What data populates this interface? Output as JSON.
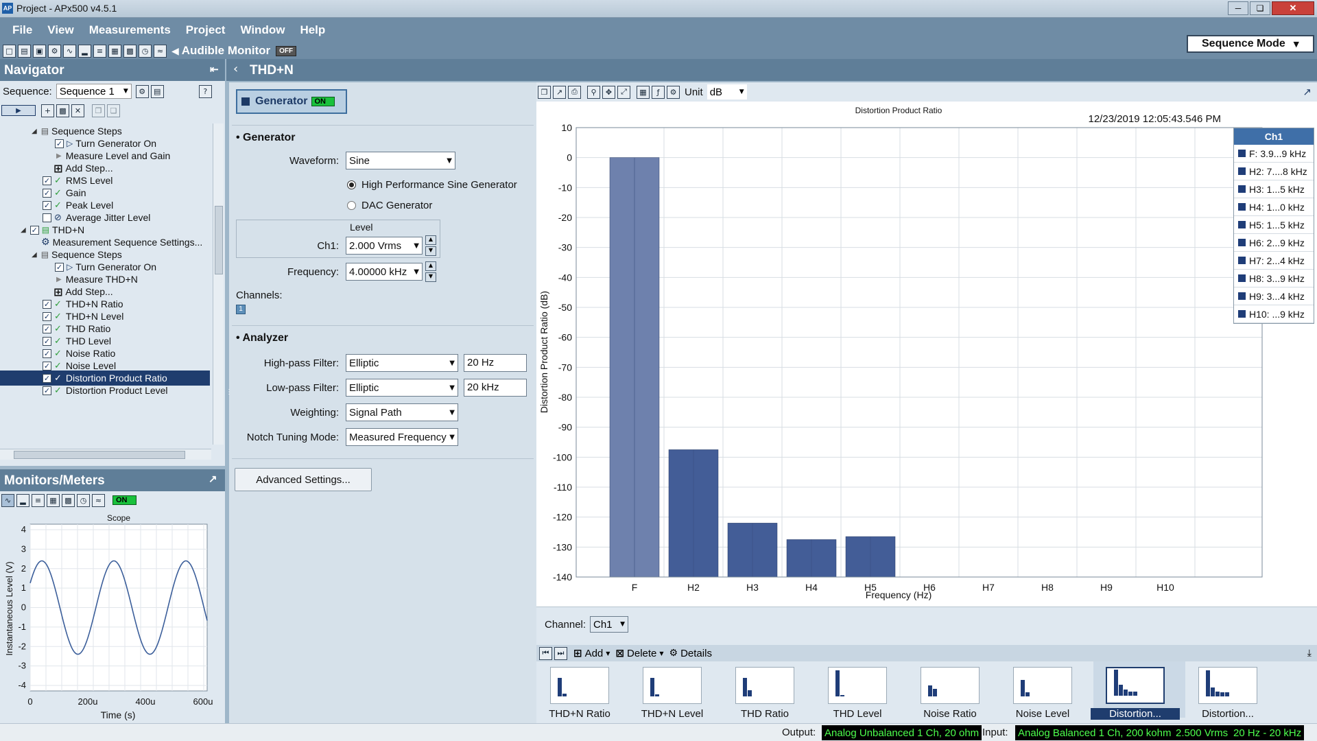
{
  "titlebar": {
    "title": "Project - APx500 v4.5.1"
  },
  "menu": {
    "items": [
      "File",
      "View",
      "Measurements",
      "Project",
      "Window",
      "Help"
    ],
    "audible_monitor": "Audible Monitor",
    "audible_state": "OFF",
    "mode": "Sequence Mode"
  },
  "navigator": {
    "title": "Navigator",
    "sequence_label": "Sequence:",
    "sequence_value": "Sequence 1",
    "items": [
      "Sequence Steps",
      "Turn Generator On",
      "Measure Level and Gain",
      "Add Step...",
      "RMS Level",
      "Gain",
      "Peak Level",
      "Average Jitter Level",
      "THD+N",
      "Measurement Sequence Settings...",
      "Sequence Steps",
      "Turn Generator On",
      "Measure THD+N",
      "Add Step...",
      "THD+N Ratio",
      "THD+N Level",
      "THD Ratio",
      "THD Level",
      "Noise Ratio",
      "Noise Level",
      "Distortion Product Ratio",
      "Distortion Product Level"
    ]
  },
  "monitors": {
    "title": "Monitors/Meters",
    "state": "ON",
    "scope": {
      "title": "Scope",
      "ylabel": "Instantaneous Level (V)",
      "xlabel": "Time (s)",
      "yticks": [
        "4",
        "3",
        "2",
        "1",
        "0",
        "-1",
        "-2",
        "-3",
        "-4"
      ],
      "xticks": [
        "0",
        "200u",
        "400u",
        "600u"
      ]
    }
  },
  "measurement": {
    "title": "THD+N"
  },
  "generator": {
    "button": "Generator",
    "state": "ON",
    "section": "Generator",
    "waveform_label": "Waveform:",
    "waveform": "Sine",
    "radio1": "High Performance Sine Generator",
    "radio2": "DAC Generator",
    "level_label": "Level",
    "ch1_label": "Ch1:",
    "ch1_value": "2.000 Vrms",
    "freq_label": "Frequency:",
    "freq_value": "4.00000 kHz",
    "channels_label": "Channels:",
    "channel_badge": "1"
  },
  "analyzer": {
    "section": "Analyzer",
    "hp_label": "High-pass Filter:",
    "hp_value": "Elliptic",
    "hp_freq": "20 Hz",
    "lp_label": "Low-pass Filter:",
    "lp_value": "Elliptic",
    "lp_freq": "20 kHz",
    "weight_label": "Weighting:",
    "weight_value": "Signal Path",
    "notch_label": "Notch Tuning Mode:",
    "notch_value": "Measured Frequency",
    "advanced": "Advanced Settings..."
  },
  "graph_toolbar": {
    "unit_label": "Unit",
    "unit_value": "dB"
  },
  "chart_data": {
    "type": "bar",
    "title": "Distortion Product Ratio",
    "timestamp": "12/23/2019 12:05:43.546 PM",
    "xlabel": "Frequency (Hz)",
    "ylabel": "Distortion Product Ratio (dB)",
    "categories": [
      "F",
      "H2",
      "H3",
      "H4",
      "H5",
      "H6",
      "H7",
      "H8",
      "H9",
      "H10"
    ],
    "values": [
      0,
      -97.5,
      -122,
      -127.5,
      -126.5,
      null,
      null,
      null,
      null,
      null
    ],
    "ylim": [
      -140,
      10
    ],
    "yticks": [
      10,
      0,
      -10,
      -20,
      -30,
      -40,
      -50,
      -60,
      -70,
      -80,
      -90,
      -100,
      -110,
      -120,
      -130,
      -140
    ],
    "colors": [
      "#6e81ad",
      "#435d97",
      "#435d97",
      "#435d97",
      "#435d97"
    ],
    "legend": {
      "header": "Ch1",
      "entries": [
        "F: 3.9...9 kHz",
        "H2: 7....8 kHz",
        "H3: 1...5 kHz",
        "H4: 1...0 kHz",
        "H5: 1...5 kHz",
        "H6: 2...9 kHz",
        "H7: 2...4 kHz",
        "H8: 3...9 kHz",
        "H9: 3...4 kHz",
        "H10: ...9 kHz"
      ]
    }
  },
  "channel_select": {
    "label": "Channel:",
    "value": "Ch1"
  },
  "results_bar": {
    "add": "Add",
    "delete": "Delete",
    "details": "Details"
  },
  "results": [
    "THD+N Ratio",
    "THD+N Level",
    "THD Ratio",
    "THD Level",
    "Noise Ratio",
    "Noise Level",
    "Distortion...",
    "Distortion..."
  ],
  "statusbar": {
    "output_label": "Output:",
    "output": "Analog Unbalanced 1 Ch, 20 ohm",
    "input_label": "Input:",
    "input": "Analog Balanced 1 Ch, 200 kohm",
    "level": "2.500 Vrms",
    "bandwidth": "20 Hz - 20 kHz"
  }
}
